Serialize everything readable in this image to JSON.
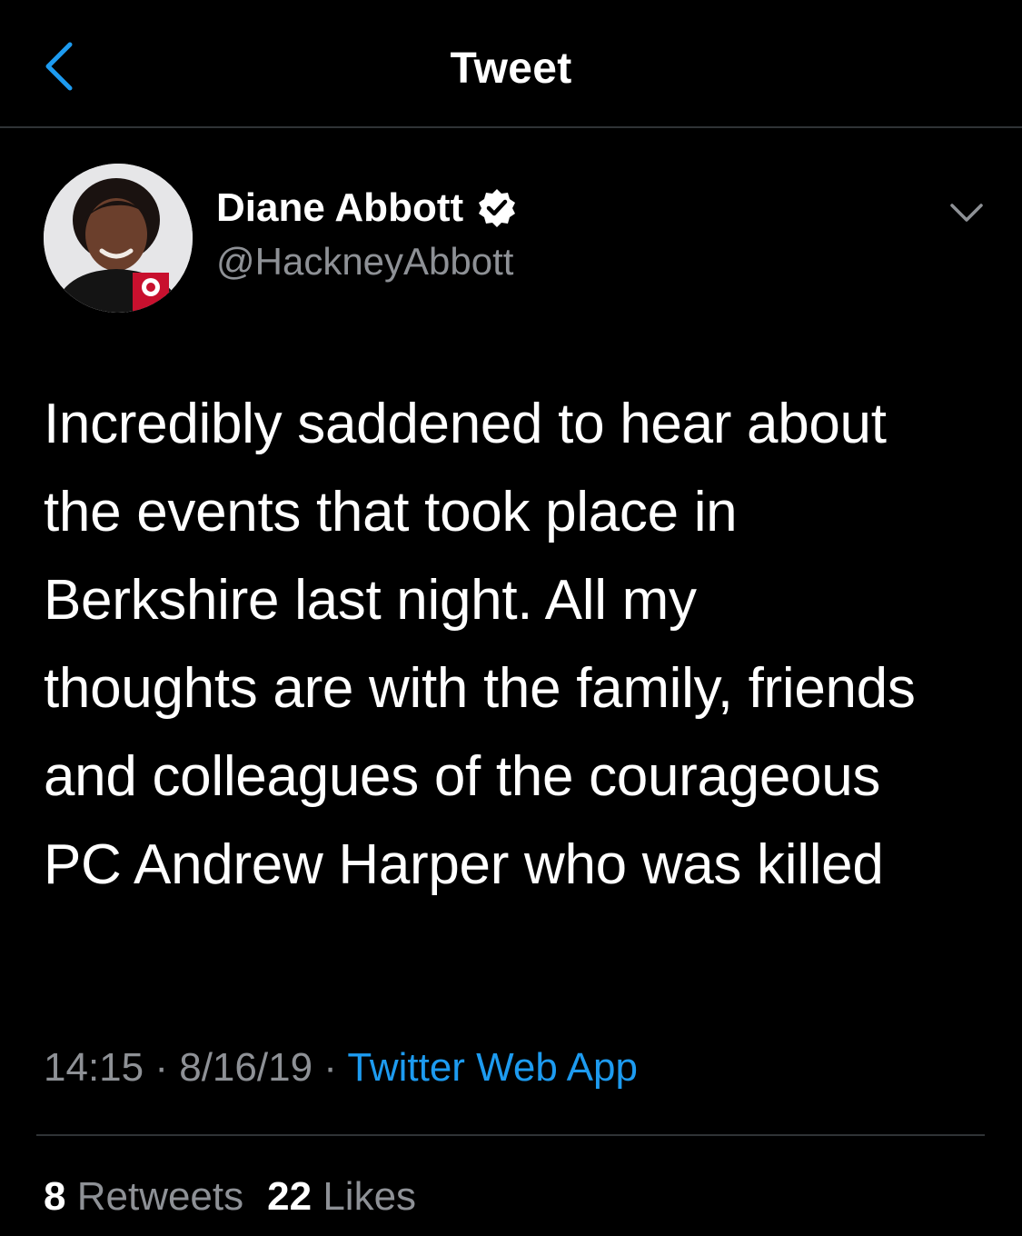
{
  "header": {
    "title": "Tweet",
    "back_icon": "chevron-left-icon"
  },
  "colors": {
    "background": "#000000",
    "accent": "#1d9bf0",
    "secondary_text": "#8e9196",
    "divider": "#2f3336"
  },
  "author": {
    "name": "Diane Abbott",
    "handle": "@HackneyAbbott",
    "verified_icon": "verified-badge-icon",
    "menu_icon": "chevron-down-icon"
  },
  "tweet": {
    "lines": [
      "Incredibly saddened to hear about",
      "the events that took place in",
      "Berkshire last night. All my",
      "thoughts are with the family, friends",
      "and colleagues of the courageous",
      "PC Andrew Harper who was killed"
    ],
    "time": "14:15",
    "separator": "·",
    "date": "8/16/19",
    "source": "Twitter Web App"
  },
  "stats": {
    "retweets_count": "8",
    "retweets_label": "Retweets",
    "likes_count": "22",
    "likes_label": "Likes"
  }
}
